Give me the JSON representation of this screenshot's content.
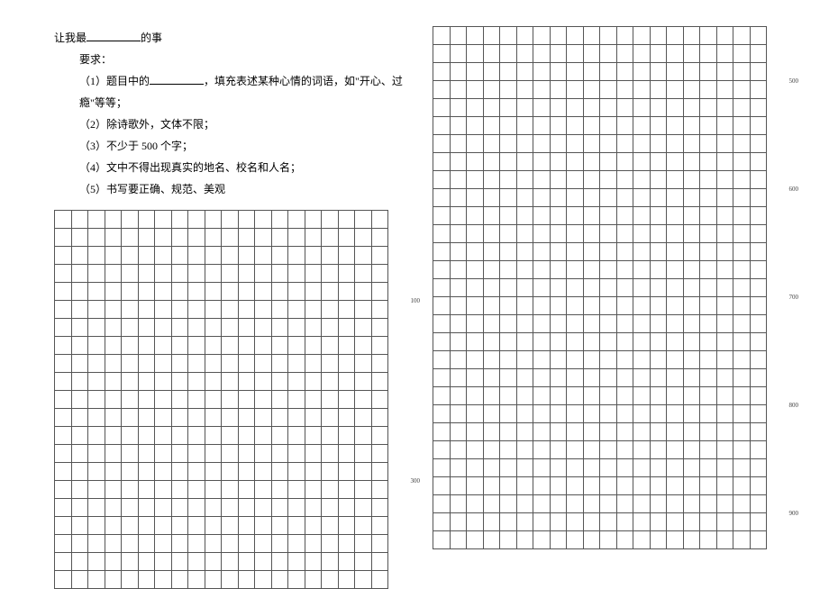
{
  "title_prefix": "让我最",
  "title_suffix": "的事",
  "req_header": "要求：",
  "req1_a": "（1）题目中的",
  "req1_b": "，填充表述某种心情的词语，如\"开心、过瘾\"等等；",
  "req2": "（2）除诗歌外，文体不限；",
  "req3": "（3）不少于 500 个字；",
  "req4": "（4）文中不得出现真实的地名、校名和人名；",
  "req5": "（5）书写要正确、规范、美观",
  "grid": {
    "cols": 20,
    "left_rows": 21,
    "right_rows": 29,
    "markers": {
      "left": [
        {
          "row_index": 4,
          "label": "100"
        },
        {
          "row_index": 14,
          "label": "300"
        }
      ],
      "right": [
        {
          "row_index": 2,
          "label": "500"
        },
        {
          "row_index": 8,
          "label": "600"
        },
        {
          "row_index": 14,
          "label": "700"
        },
        {
          "row_index": 20,
          "label": "800"
        },
        {
          "row_index": 26,
          "label": "900"
        }
      ]
    }
  }
}
